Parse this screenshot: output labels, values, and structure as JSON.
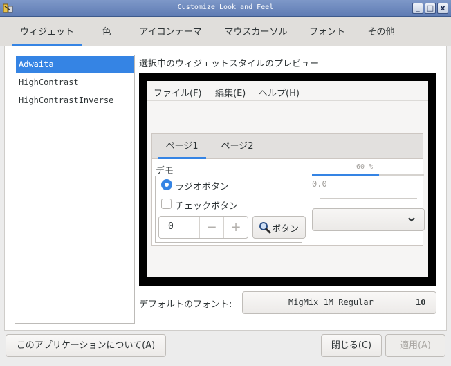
{
  "window": {
    "title": "Customize Look and Feel",
    "accent": "#3584e4"
  },
  "titlebar": {
    "minimize_label": "_",
    "maximize_label": "□",
    "close_label": "x"
  },
  "tabs": [
    {
      "label": "ウィジェット",
      "active": true
    },
    {
      "label": "色"
    },
    {
      "label": "アイコンテーマ"
    },
    {
      "label": "マウスカーソル"
    },
    {
      "label": "フォント"
    },
    {
      "label": "その他"
    }
  ],
  "styles": [
    {
      "label": "Adwaita",
      "selected": true
    },
    {
      "label": "HighContrast"
    },
    {
      "label": "HighContrastInverse"
    }
  ],
  "preview": {
    "heading": "選択中のウィジェットスタイルのプレビュー",
    "menu": [
      "ファイル(F)",
      "編集(E)",
      "ヘルプ(H)"
    ],
    "tabs": [
      "ページ1",
      "ページ2"
    ],
    "demo_label": "デモ",
    "radio_label": "ラジオボタン",
    "check_label": "チェックボタン",
    "spin_value": "0",
    "spin_minus": "−",
    "spin_plus": "+",
    "button_label": "ボタン",
    "progress_text": "60 %",
    "progress_fraction": 0.6,
    "scale_value": "0.0"
  },
  "font": {
    "label": "デフォルトのフォント:",
    "name": "MigMix 1M Regular",
    "size": "10"
  },
  "footer": {
    "about_label": "このアプリケーションについて(A)",
    "close_label": "閉じる(C)",
    "apply_label": "適用(A)"
  }
}
